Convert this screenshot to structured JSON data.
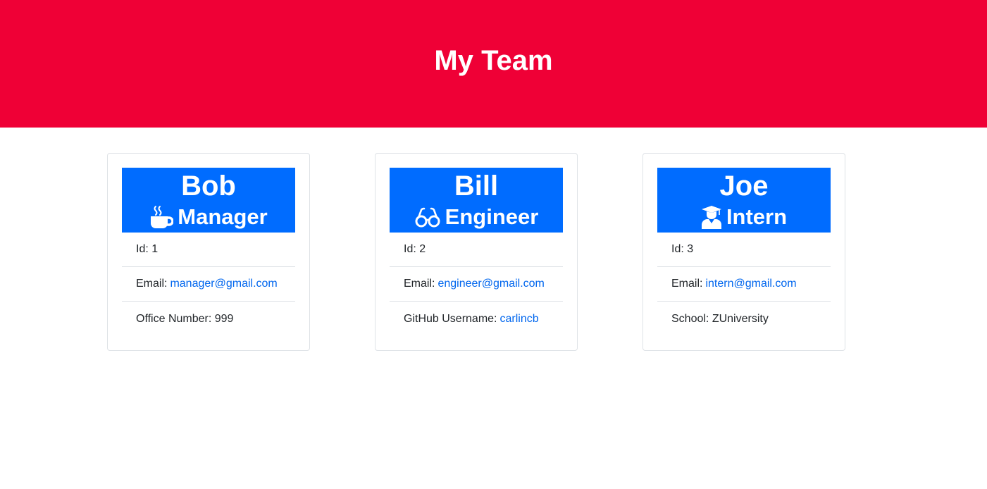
{
  "header": {
    "title": "My Team"
  },
  "team": [
    {
      "name": "Bob",
      "role": "Manager",
      "icon": "coffee-mug-icon",
      "id_label": "Id: 1",
      "email_label": "Email:",
      "email": "manager@gmail.com",
      "extra_label": "Office Number: 999"
    },
    {
      "name": "Bill",
      "role": "Engineer",
      "icon": "glasses-icon",
      "id_label": "Id: 2",
      "email_label": "Email:",
      "email": "engineer@gmail.com",
      "extra_label": "GitHub Username:",
      "extra_link": "carlincb"
    },
    {
      "name": "Joe",
      "role": "Intern",
      "icon": "graduate-icon",
      "id_label": "Id: 3",
      "email_label": "Email:",
      "email": "intern@gmail.com",
      "extra_label": "School: ZUniversity"
    }
  ],
  "colors": {
    "header_bg": "#ef0036",
    "card_header_bg": "#006cff",
    "link": "#0066ee"
  }
}
